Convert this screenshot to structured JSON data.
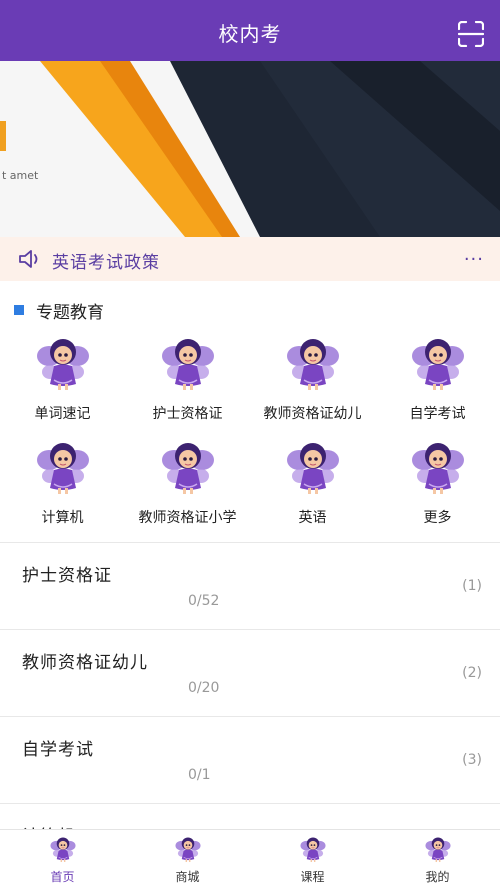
{
  "header": {
    "title": "校内考",
    "scan_icon": "scan-icon"
  },
  "banner": {
    "caption": "t amet",
    "slides_total": 3,
    "active_slide": 1
  },
  "notice": {
    "text": "英语考试政策",
    "more": "···",
    "icon": "speaker-icon"
  },
  "section": {
    "title": "专题教育",
    "marker_color": "#2f7de1"
  },
  "topics": [
    {
      "label": "单词速记",
      "icon": "fairy-icon"
    },
    {
      "label": "护士资格证",
      "icon": "fairy-icon"
    },
    {
      "label": "教师资格证幼儿",
      "icon": "fairy-icon"
    },
    {
      "label": "自学考试",
      "icon": "fairy-icon"
    },
    {
      "label": "计算机",
      "icon": "fairy-icon"
    },
    {
      "label": "教师资格证小学",
      "icon": "fairy-icon"
    },
    {
      "label": "英语",
      "icon": "fairy-icon"
    },
    {
      "label": "更多",
      "icon": "fairy-icon"
    }
  ],
  "courses": [
    {
      "name": "护士资格证",
      "progress": "0/52",
      "count": "(1)"
    },
    {
      "name": "教师资格证幼儿",
      "progress": "0/20",
      "count": "(2)"
    },
    {
      "name": "自学考试",
      "progress": "0/1",
      "count": "(3)"
    },
    {
      "name": "计算机",
      "progress": "",
      "count": ""
    }
  ],
  "tabbar": [
    {
      "label": "首页",
      "active": true
    },
    {
      "label": "商城",
      "active": false
    },
    {
      "label": "课程",
      "active": false
    },
    {
      "label": "我的",
      "active": false
    }
  ],
  "colors": {
    "primary": "#6a3cb5",
    "notice_bg": "#fdf1ea",
    "notice_text": "#5a3ea2",
    "muted": "#999999"
  }
}
